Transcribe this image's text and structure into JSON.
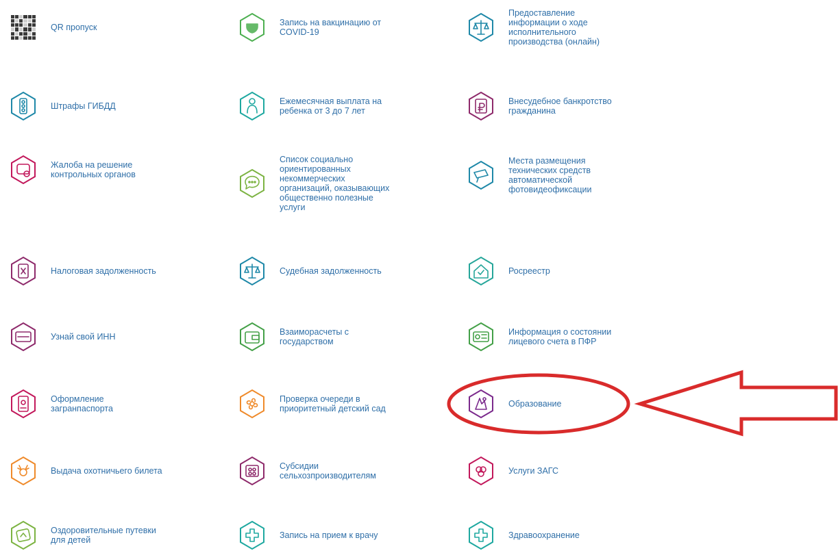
{
  "colors": {
    "label": "#2f6fa8",
    "annotation": "#d92b2b"
  },
  "tiles": [
    {
      "label": "QR пропуск",
      "icon": "qr-code-icon",
      "color": "#444444"
    },
    {
      "label": "Запись на вакцинацию от\nCOVID-19",
      "icon": "shield-vaccine-icon",
      "color": "#4caf50"
    },
    {
      "label": "Предоставление\nинформации о ходе\nисполнительного\nпроизводства (онлайн)",
      "icon": "scales-icon",
      "color": "#1e88a8"
    },
    {
      "label": "Штрафы ГИБДД",
      "icon": "traffic-light-icon",
      "color": "#1e88a8"
    },
    {
      "label": "Ежемесячная выплата на\nребенка от 3 до 7 лет",
      "icon": "child-icon",
      "color": "#1ea8a0"
    },
    {
      "label": "Внесудебное банкротство\nгражданина",
      "icon": "document-ruble-icon",
      "color": "#8e2a6b"
    },
    {
      "label": "Жалоба на решение\nконтрольных органов",
      "icon": "complaint-icon",
      "color": "#c2185b"
    },
    {
      "label": "Список социально\nориентированных\nнекоммерческих\nорганизаций, оказывающих\nобщественно полезные\nуслуги",
      "icon": "chat-bubble-icon",
      "color": "#7cb342"
    },
    {
      "label": "Места размещения\nтехнических средств\nавтоматической\nфотовидеофиксации",
      "icon": "camera-icon",
      "color": "#1e88a8"
    },
    {
      "label": "Налоговая задолженность",
      "icon": "tax-document-icon",
      "color": "#8e2a6b"
    },
    {
      "label": "Судебная задолженность",
      "icon": "scales-icon",
      "color": "#1e88a8"
    },
    {
      "label": "Росреестр",
      "icon": "house-icon",
      "color": "#26a69a"
    },
    {
      "label": "Узнай свой ИНН",
      "icon": "id-card-icon",
      "color": "#8e2a6b"
    },
    {
      "label": "Взаиморасчеты с\nгосударством",
      "icon": "wallet-icon",
      "color": "#43a047"
    },
    {
      "label": "Информация о состоянии\nлицевого счета в ПФР",
      "icon": "account-card-icon",
      "color": "#43a047"
    },
    {
      "label": "Оформление\nзагранпаспорта",
      "icon": "passport-icon",
      "color": "#c2185b"
    },
    {
      "label": "Проверка очереди в\nприоритетный детский сад",
      "icon": "kindergarten-icon",
      "color": "#ef8a2a"
    },
    {
      "label": "Образование",
      "icon": "education-icon",
      "color": "#7b2a8c"
    },
    {
      "label": "Выдача охотничьего билета",
      "icon": "deer-icon",
      "color": "#ef8a2a"
    },
    {
      "label": "Субсидии\nсельхозпроизводителям",
      "icon": "farm-subsidy-icon",
      "color": "#8e2a6b"
    },
    {
      "label": "Услуги ЗАГС",
      "icon": "rings-icon",
      "color": "#c2185b"
    },
    {
      "label": "Оздоровительные путевки\nдля детей",
      "icon": "voucher-icon",
      "color": "#7cb342"
    },
    {
      "label": "Запись на прием к врачу",
      "icon": "medical-cross-icon",
      "color": "#1ea8a0"
    },
    {
      "label": "Здравоохранение",
      "icon": "medical-cross-icon",
      "color": "#1ea8a0"
    }
  ]
}
